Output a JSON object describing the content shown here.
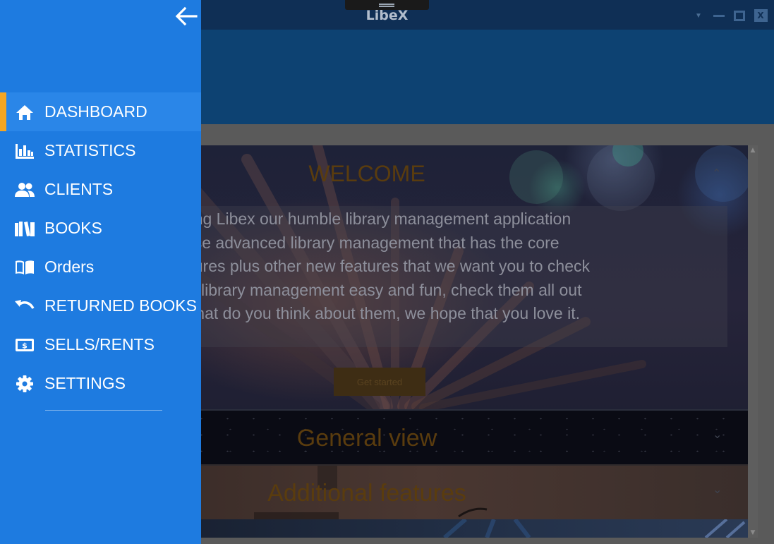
{
  "window": {
    "title": "LibeX"
  },
  "nav": {
    "items": [
      {
        "label": "DASHBOARD",
        "icon": "home-icon",
        "active": true
      },
      {
        "label": "STATISTICS",
        "icon": "bar-chart-icon",
        "active": false
      },
      {
        "label": "CLIENTS",
        "icon": "people-icon",
        "active": false
      },
      {
        "label": "BOOKS",
        "icon": "books-icon",
        "active": false
      },
      {
        "label": "Orders",
        "icon": "open-book-icon",
        "active": false
      },
      {
        "label": "RETURNED BOOKS",
        "icon": "undo-icon",
        "active": false
      },
      {
        "label": "SELLS/RENTS",
        "icon": "cash-icon",
        "active": false
      },
      {
        "label": "SETTINGS",
        "icon": "gear-icon",
        "active": false
      }
    ]
  },
  "welcome": {
    "title": "WELCOME",
    "text": "r trying Libex our humble library management application\n to use advanced library management that has the core\n features plus other new features that we want you to check\nakes library management easy and fun, check them all out\nnk what do you think about them, we hope that you love it.",
    "button": "Get started"
  },
  "sections": {
    "general": "General view",
    "additional": "Additional features"
  },
  "colors": {
    "drawer": "#1e7be0",
    "active_indicator": "#f5a623",
    "header": "#0d4272",
    "section_title": "#5a3c0e"
  }
}
